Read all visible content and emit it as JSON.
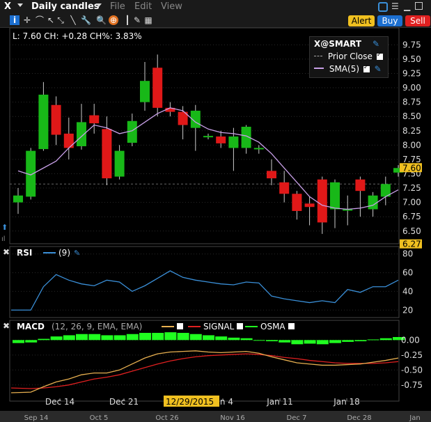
{
  "window": {
    "symbol": "X",
    "title": "Daily candles",
    "menu": [
      {
        "label": "File"
      },
      {
        "label": "Edit"
      },
      {
        "label": "View"
      }
    ],
    "buttons": {
      "alert": "Alert",
      "buy": "Buy",
      "sell": "Sell"
    },
    "icons": [
      "i-icon",
      "crosshair-icon",
      "pointer-icon",
      "magnifier-icon",
      "target-icon",
      "ruler-icon",
      "more-icons"
    ]
  },
  "status_line": "L: 7.60 CH: +0.28 CH%: 3.83%",
  "legend": {
    "title": "X@SMART",
    "items": [
      {
        "label": "Prior Close",
        "style": "dash"
      },
      {
        "label": "SMA(5)",
        "color": "#c8a0e8"
      }
    ]
  },
  "price_tag": "7.60",
  "low_tag": "6.27",
  "rsi_label": "RSI",
  "rsi_period": "(9)",
  "macd_label": "MACD",
  "macd_params": "(12, 26, 9, EMA, EMA)",
  "macd_signal": "SIGNAL",
  "macd_osma": "OSMA",
  "time_axis": {
    "primary": [
      "Dec 14",
      "Dec 21",
      "Jan 4",
      "Jan 11",
      "Jan 18"
    ],
    "cursor_date": "12/29/2015",
    "overview": [
      "Sep 14",
      "Oct 5",
      "Oct 26",
      "Nov 16",
      "Dec 7",
      "Dec 28",
      "Jan"
    ]
  },
  "chart_data": [
    {
      "type": "candlestick",
      "title": "Daily candles",
      "y_ticks": [
        "9.75",
        "9.50",
        "9.25",
        "9.00",
        "8.75",
        "8.50",
        "8.25",
        "8.00",
        "7.75",
        "7.50",
        "7.25",
        "7.00",
        "6.75",
        "6.50"
      ],
      "ylim": [
        6.4,
        9.9
      ],
      "prior_close": 7.32,
      "candles": [
        {
          "o": 7.0,
          "c": 7.12,
          "h": 7.25,
          "l": 6.8
        },
        {
          "o": 7.1,
          "c": 7.9,
          "h": 7.95,
          "l": 7.05
        },
        {
          "o": 7.93,
          "c": 8.88,
          "h": 9.1,
          "l": 7.9
        },
        {
          "o": 8.7,
          "c": 8.18,
          "h": 8.85,
          "l": 8.0
        },
        {
          "o": 8.2,
          "c": 7.95,
          "h": 8.48,
          "l": 7.75
        },
        {
          "o": 7.98,
          "c": 8.4,
          "h": 8.72,
          "l": 7.92
        },
        {
          "o": 8.52,
          "c": 8.38,
          "h": 8.72,
          "l": 8.2
        },
        {
          "o": 8.28,
          "c": 7.42,
          "h": 8.5,
          "l": 7.3
        },
        {
          "o": 7.45,
          "c": 7.9,
          "h": 8.0,
          "l": 7.4
        },
        {
          "o": 8.04,
          "c": 8.42,
          "h": 8.55,
          "l": 7.98
        },
        {
          "o": 8.75,
          "c": 9.12,
          "h": 9.45,
          "l": 8.6
        },
        {
          "o": 9.35,
          "c": 8.65,
          "h": 9.58,
          "l": 8.5
        },
        {
          "o": 8.65,
          "c": 8.58,
          "h": 8.75,
          "l": 8.5
        },
        {
          "o": 8.58,
          "c": 8.35,
          "h": 8.68,
          "l": 8.1
        },
        {
          "o": 8.3,
          "c": 8.6,
          "h": 8.7,
          "l": 7.9
        },
        {
          "o": 8.16,
          "c": 8.16,
          "h": 8.2,
          "l": 8.1
        },
        {
          "o": 8.15,
          "c": 8.03,
          "h": 8.25,
          "l": 7.95
        },
        {
          "o": 7.95,
          "c": 8.15,
          "h": 8.3,
          "l": 7.55
        },
        {
          "o": 7.95,
          "c": 8.32,
          "h": 8.35,
          "l": 7.85
        },
        {
          "o": 7.95,
          "c": 7.95,
          "h": 8.0,
          "l": 7.85
        },
        {
          "o": 7.55,
          "c": 7.42,
          "h": 7.75,
          "l": 7.3
        },
        {
          "o": 7.35,
          "c": 7.15,
          "h": 7.55,
          "l": 7.0
        },
        {
          "o": 7.15,
          "c": 6.85,
          "h": 7.2,
          "l": 6.7
        },
        {
          "o": 6.98,
          "c": 6.92,
          "h": 7.1,
          "l": 6.6
        },
        {
          "o": 7.4,
          "c": 6.65,
          "h": 7.45,
          "l": 6.45
        },
        {
          "o": 6.88,
          "c": 7.35,
          "h": 7.4,
          "l": 6.55
        },
        {
          "o": 6.88,
          "c": 6.88,
          "h": 7.12,
          "l": 6.6
        },
        {
          "o": 7.4,
          "c": 7.2,
          "h": 7.45,
          "l": 6.75
        },
        {
          "o": 6.88,
          "c": 7.12,
          "h": 7.18,
          "l": 6.75
        },
        {
          "o": 7.1,
          "c": 7.32,
          "h": 7.45,
          "l": 6.95
        },
        {
          "o": 7.52,
          "c": 7.6,
          "h": 7.65,
          "l": 7.45
        }
      ],
      "sma5": [
        7.55,
        7.48,
        7.6,
        7.72,
        7.95,
        8.15,
        8.35,
        8.3,
        8.2,
        8.25,
        8.4,
        8.55,
        8.65,
        8.6,
        8.4,
        8.28,
        8.22,
        8.2,
        8.16,
        8.05,
        7.85,
        7.6,
        7.35,
        7.1,
        6.95,
        6.9,
        6.88,
        6.9,
        6.95,
        7.1,
        7.22
      ]
    },
    {
      "type": "line",
      "title": "RSI",
      "y_ticks": [
        "80",
        "60",
        "40",
        "20"
      ],
      "ylim": [
        15,
        85
      ],
      "series": [
        {
          "name": "(9)",
          "color": "#3a8fd8",
          "values": [
            20,
            20,
            45,
            58,
            52,
            48,
            46,
            52,
            50,
            40,
            46,
            54,
            62,
            55,
            52,
            50,
            48,
            47,
            50,
            49,
            35,
            32,
            30,
            28,
            30,
            28,
            42,
            39,
            45,
            45,
            52
          ]
        }
      ]
    },
    {
      "type": "line",
      "title": "MACD",
      "y_ticks": [
        "0.00",
        "-0.25",
        "-0.50",
        "-0.75"
      ],
      "ylim": [
        -0.95,
        0.12
      ],
      "series": [
        {
          "name": "MACD",
          "color": "#e8b050",
          "values": [
            -0.88,
            -0.87,
            -0.78,
            -0.7,
            -0.65,
            -0.58,
            -0.55,
            -0.55,
            -0.5,
            -0.4,
            -0.3,
            -0.23,
            -0.2,
            -0.19,
            -0.18,
            -0.2,
            -0.21,
            -0.2,
            -0.19,
            -0.22,
            -0.28,
            -0.33,
            -0.38,
            -0.4,
            -0.42,
            -0.42,
            -0.41,
            -0.4,
            -0.37,
            -0.34,
            -0.3
          ]
        },
        {
          "name": "SIGNAL",
          "color": "#e02020",
          "values": [
            -0.8,
            -0.81,
            -0.8,
            -0.78,
            -0.75,
            -0.7,
            -0.65,
            -0.62,
            -0.58,
            -0.52,
            -0.46,
            -0.4,
            -0.35,
            -0.31,
            -0.28,
            -0.26,
            -0.25,
            -0.24,
            -0.23,
            -0.24,
            -0.26,
            -0.29,
            -0.31,
            -0.34,
            -0.36,
            -0.38,
            -0.39,
            -0.39,
            -0.39,
            -0.38,
            -0.36
          ]
        },
        {
          "name": "OSMA",
          "color": "#20ff20",
          "values": [
            -0.05,
            -0.04,
            0.02,
            0.06,
            0.08,
            0.1,
            0.1,
            0.08,
            0.08,
            0.1,
            0.12,
            0.12,
            0.13,
            0.12,
            0.1,
            0.08,
            0.06,
            0.04,
            0.03,
            0.0,
            -0.02,
            -0.04,
            -0.07,
            -0.06,
            -0.07,
            -0.05,
            -0.03,
            -0.02,
            0.01,
            0.03,
            0.05
          ]
        }
      ]
    }
  ]
}
